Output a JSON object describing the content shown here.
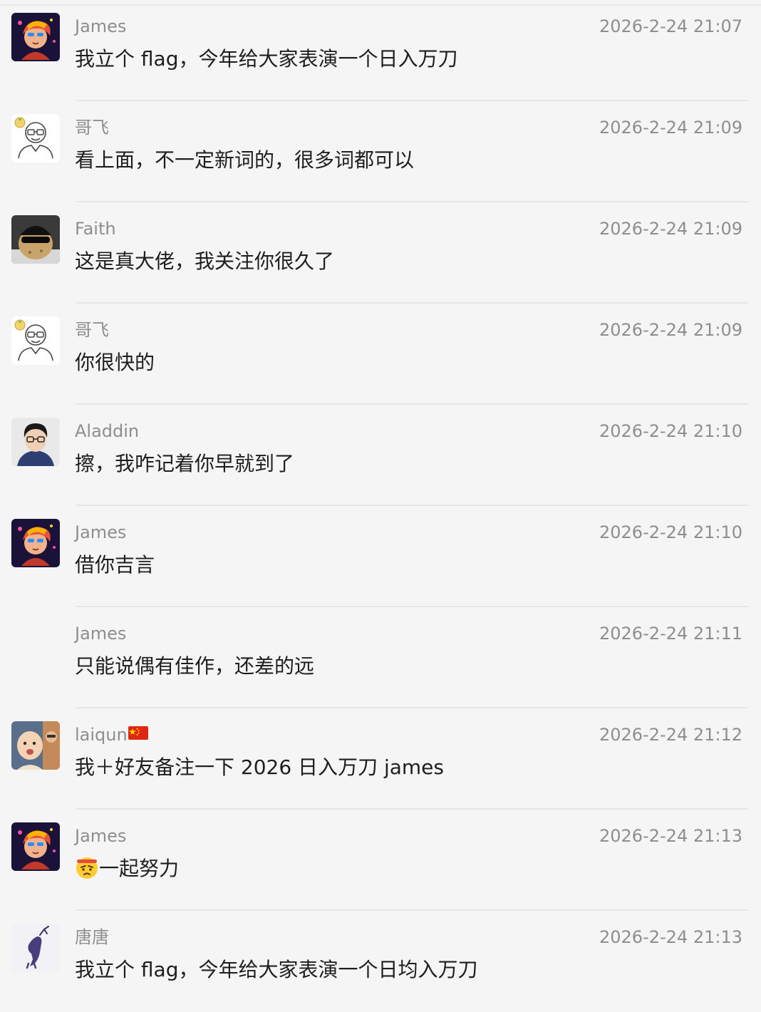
{
  "messages": [
    {
      "name": "James",
      "time": "2026-2-24 21:07",
      "text": "我立个 flag，今年给大家表演一个日入万刀",
      "avatar": "james-anime-avatar"
    },
    {
      "name": "哥飞",
      "time": "2026-2-24 21:09",
      "text": "看上面，不一定新词的，很多词都可以",
      "avatar": "gefei-sketch-avatar"
    },
    {
      "name": "Faith",
      "time": "2026-2-24 21:09",
      "text": "这是真大佬，我关注你很久了",
      "avatar": "faith-sunglasses-avatar"
    },
    {
      "name": "哥飞",
      "time": "2026-2-24 21:09",
      "text": "你很快的",
      "avatar": "gefei-sketch-avatar"
    },
    {
      "name": "Aladdin",
      "time": "2026-2-24 21:10",
      "text": "擦，我咋记着你早就到了",
      "avatar": "aladdin-photo-avatar"
    },
    {
      "name": "James",
      "time": "2026-2-24 21:10",
      "text": "借你吉言",
      "avatar": "james-anime-avatar"
    },
    {
      "name": "James",
      "time": "2026-2-24 21:11",
      "text": "只能说偶有佳作，还差的远",
      "avatar": ""
    },
    {
      "name": "laiqun",
      "time": "2026-2-24 21:12",
      "text": "我＋好友备注一下 2026 日入万刀 james",
      "avatar": "laiqun-baby-photo-avatar",
      "name_icon": "china-flag-icon"
    },
    {
      "name": "James",
      "time": "2026-2-24 21:13",
      "text": "一起努力",
      "avatar": "james-anime-avatar",
      "msg_icon": "determined-face-emoji-icon"
    },
    {
      "name": "唐唐",
      "time": "2026-2-24 21:13",
      "text": "我立个 flag，今年给大家表演一个日均入万刀",
      "avatar": "tangtang-deer-avatar"
    }
  ],
  "colors": {
    "background": "#f5f5f5",
    "name_text": "#8e8e8e",
    "time_text": "#8e8e8e",
    "message_text": "#1e1e1e",
    "divider": "#e6e6e6"
  }
}
